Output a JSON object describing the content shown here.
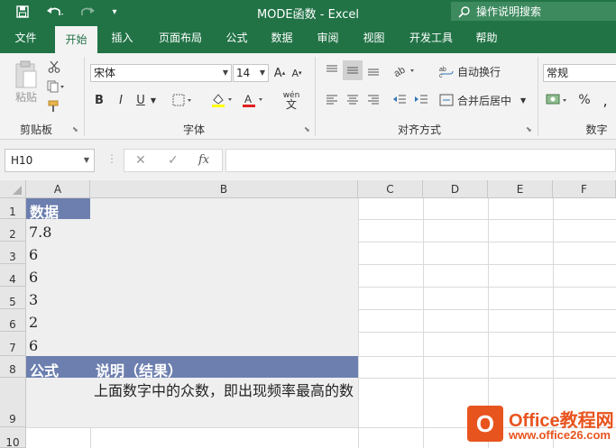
{
  "window": {
    "title": "MODE函数  -  Excel",
    "search_placeholder": "操作说明搜索",
    "accent": "#217346"
  },
  "quick_access": {
    "save_icon": "save-icon",
    "undo_icon": "undo-icon",
    "redo_icon": "redo-icon",
    "customize_icon": "customize-icon"
  },
  "tabs": [
    "文件",
    "开始",
    "插入",
    "页面布局",
    "公式",
    "数据",
    "审阅",
    "视图",
    "开发工具",
    "帮助"
  ],
  "active_tab": "开始",
  "ribbon": {
    "clipboard": {
      "paste_label": "粘贴",
      "group_label": "剪贴板"
    },
    "font": {
      "font_name": "宋体",
      "font_size": "14",
      "bold": "B",
      "italic": "I",
      "underline": "U",
      "grow": "A",
      "shrink": "A",
      "phonetic": "wén",
      "group_label": "字体"
    },
    "alignment": {
      "wrap_text": "自动换行",
      "merge_center": "合并后居中",
      "group_label": "对齐方式"
    },
    "number": {
      "format": "常规",
      "percent": "%",
      "group_label": "数字"
    }
  },
  "formula_bar": {
    "name_box": "H10",
    "cancel": "✕",
    "enter": "✓",
    "fx": "fx",
    "formula": ""
  },
  "sheet": {
    "columns": [
      "A",
      "B",
      "C",
      "D",
      "E",
      "F"
    ],
    "rows": [
      "1",
      "2",
      "3",
      "4",
      "5",
      "6",
      "7",
      "8",
      "9",
      "10"
    ],
    "cells": {
      "A1": "数据",
      "A2": "7.8",
      "A3": "6",
      "A4": "6",
      "A5": "3",
      "A6": "2",
      "A7": "6",
      "A8": "公式",
      "B8": "说明（结果）",
      "B9": "上面数字中的众数，即出现频率最高的数"
    },
    "header_fill": "#6d7faf",
    "shade_fill": "#efefef"
  },
  "watermark": {
    "icon": "office-logo-icon",
    "icon_letter": "O",
    "title": "Office教程网",
    "url": "www.office26.com",
    "color": "#e8541e"
  }
}
